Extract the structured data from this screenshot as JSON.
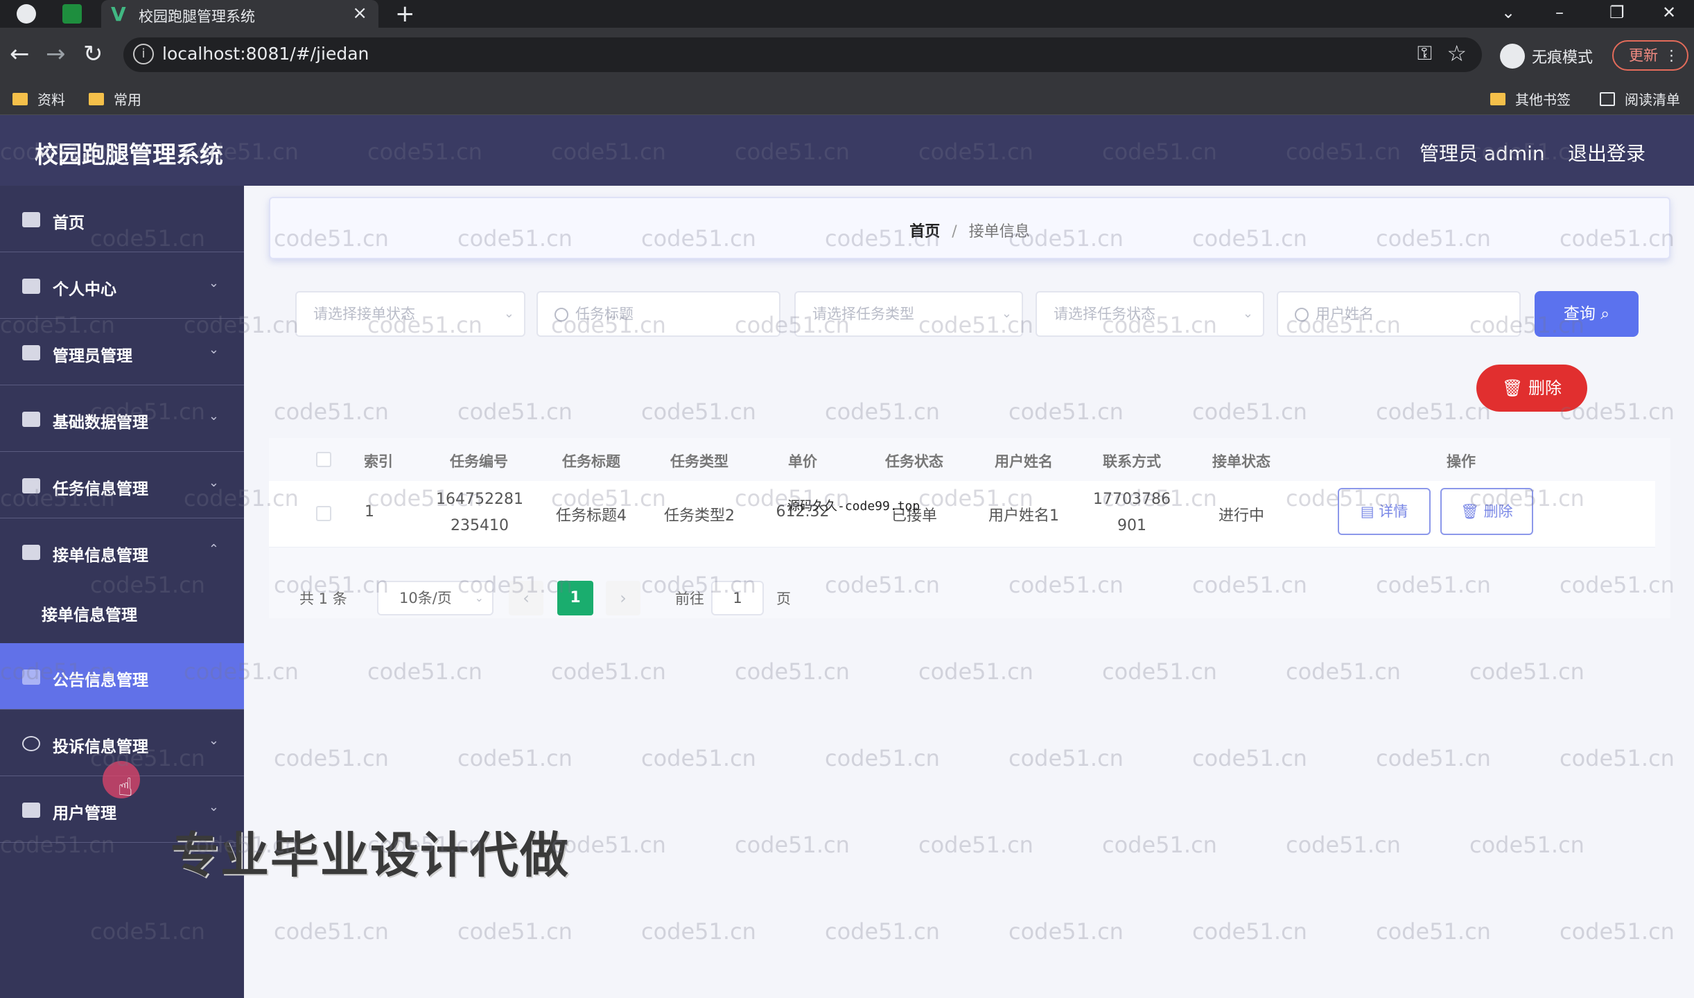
{
  "browser": {
    "tab_title": "校园跑腿管理系统",
    "url": "localhost:8081/#/jiedan",
    "incognito_label": "无痕模式",
    "update_label": "更新",
    "bookmarks": [
      "资料",
      "常用"
    ],
    "bookmarks_right": [
      "其他书签",
      "阅读清单"
    ]
  },
  "header": {
    "brand": "校园跑腿管理系统",
    "user": "管理员 admin",
    "logout": "退出登录"
  },
  "sidebar": {
    "items": [
      {
        "label": "首页",
        "icon": "home-icon"
      },
      {
        "label": "个人中心",
        "icon": "user-icon"
      },
      {
        "label": "管理员管理",
        "icon": "admin-icon"
      },
      {
        "label": "基础数据管理",
        "icon": "data-icon"
      },
      {
        "label": "任务信息管理",
        "icon": "grid-icon"
      },
      {
        "label": "接单信息管理",
        "icon": "send-icon"
      },
      {
        "label": "接单信息管理",
        "icon": "none"
      },
      {
        "label": "公告信息管理",
        "icon": "notice-icon"
      },
      {
        "label": "投诉信息管理",
        "icon": "power-icon"
      },
      {
        "label": "用户管理",
        "icon": "users-icon"
      }
    ]
  },
  "breadcrumb": {
    "home": "首页",
    "separator": "/",
    "current": "接单信息"
  },
  "search": {
    "f1_placeholder": "请选择接单状态",
    "f2_placeholder": "任务标题",
    "f3_placeholder": "请选择任务类型",
    "f4_placeholder": "请选择任务状态",
    "f5_placeholder": "用户姓名",
    "query_label": "查询",
    "delete_label": "删除"
  },
  "table": {
    "headers": [
      "索引",
      "任务编号",
      "任务标题",
      "任务类型",
      "单价",
      "任务状态",
      "用户姓名",
      "联系方式",
      "接单状态",
      "操作"
    ],
    "rows": [
      {
        "index": "1",
        "code_line1": "164752281",
        "code_line2": "235410",
        "title": "任务标题4",
        "type": "任务类型2",
        "price": "612.32",
        "task_status": "已接单",
        "user": "用户姓名1",
        "phone_line1": "17703786",
        "phone_line2": "901",
        "order_status": "进行中",
        "detail_label": "详情",
        "delete_label": "删除"
      }
    ]
  },
  "pagination": {
    "total": "共 1 条",
    "page_size": "10条/页",
    "current_page": "1",
    "goto_label": "前往",
    "goto_value": "1",
    "page_unit": "页"
  },
  "overlays": {
    "top_watermark": "源码久久-code99.top",
    "bottom_ad": "专业毕业设计代做",
    "bg_watermark": "code51.cn"
  }
}
